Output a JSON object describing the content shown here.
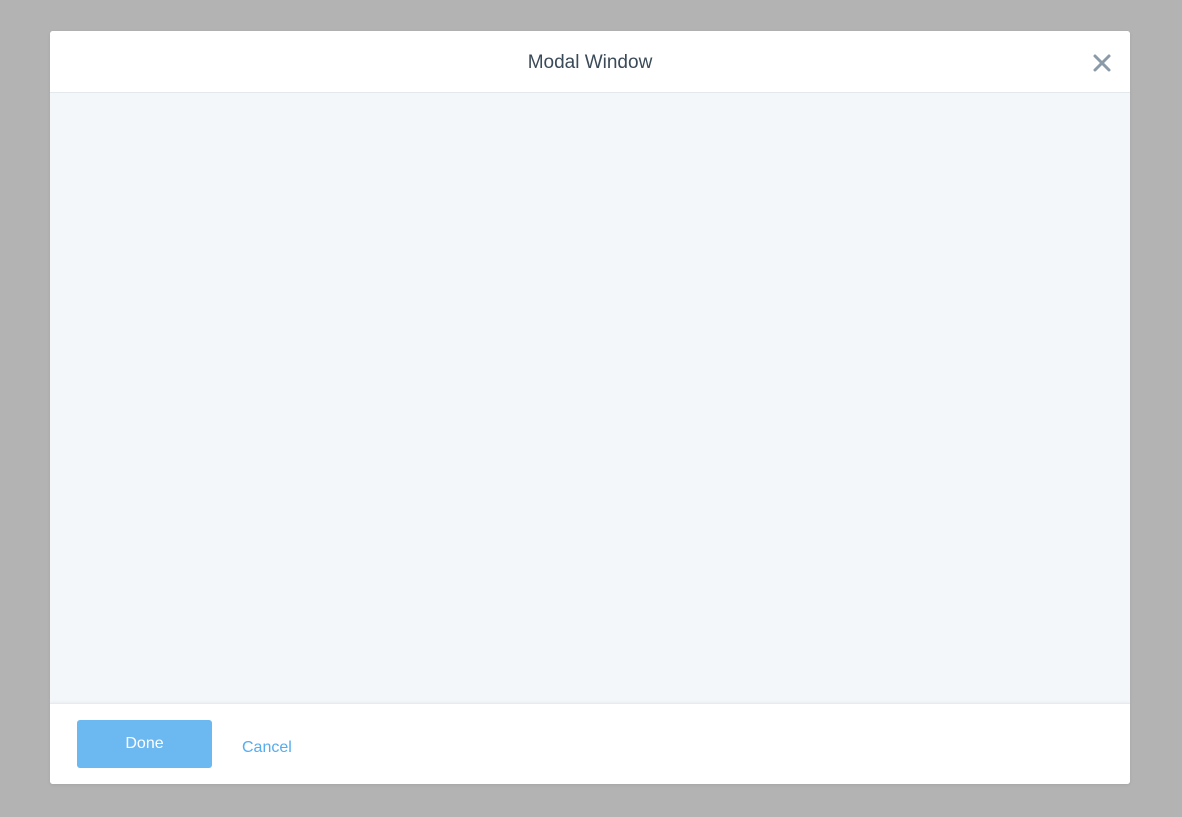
{
  "modal": {
    "title": "Modal Window",
    "close_icon": "close-icon"
  },
  "footer": {
    "done_label": "Done",
    "cancel_label": "Cancel"
  },
  "colors": {
    "backdrop": "#b3b3b3",
    "body_background": "#f3f7fa",
    "primary_button": "#6cb8f0",
    "link": "#55acee",
    "title_text": "#3a4a58",
    "close_icon": "#8a9aa8"
  }
}
